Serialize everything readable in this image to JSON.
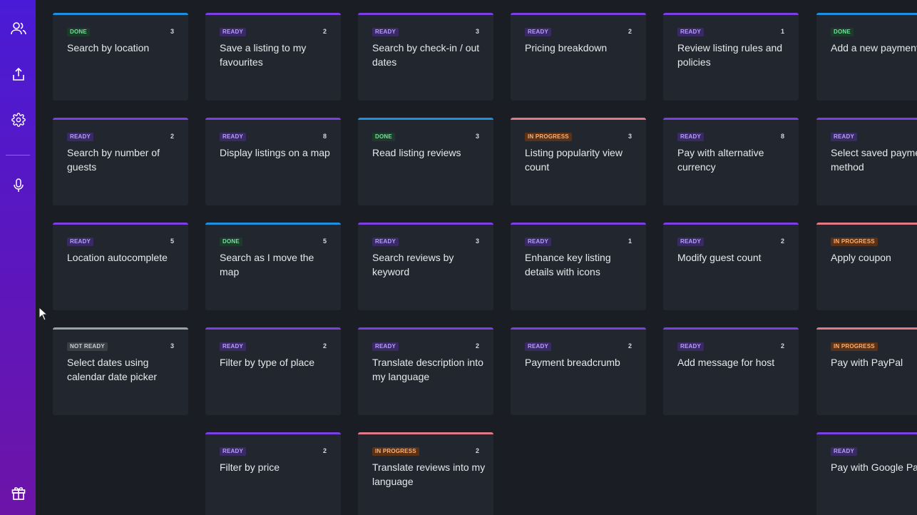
{
  "sidebar": {
    "icons": [
      "users-icon",
      "share-icon",
      "gear-icon",
      "microphone-icon",
      "gift-icon"
    ]
  },
  "columns": [
    {
      "cards": [
        {
          "status": "done",
          "badge": "DONE",
          "count": "3",
          "title": "Search by location"
        },
        {
          "status": "ready",
          "badge": "READY",
          "count": "2",
          "title": "Search by number of guests"
        },
        {
          "status": "ready",
          "badge": "READY",
          "count": "5",
          "title": "Location autocomplete"
        },
        {
          "status": "notready",
          "badge": "NOT READY",
          "count": "3",
          "title": "Select dates using calendar date picker"
        }
      ]
    },
    {
      "cards": [
        {
          "status": "ready",
          "badge": "READY",
          "count": "2",
          "title": "Save a listing to my favourites"
        },
        {
          "status": "ready",
          "badge": "READY",
          "count": "8",
          "title": "Display listings on a map"
        },
        {
          "status": "done",
          "badge": "DONE",
          "count": "5",
          "title": "Search as I move the map"
        },
        {
          "status": "ready",
          "badge": "READY",
          "count": "2",
          "title": "Filter by type of place"
        },
        {
          "status": "ready",
          "badge": "READY",
          "count": "2",
          "title": "Filter by price"
        }
      ]
    },
    {
      "cards": [
        {
          "status": "ready",
          "badge": "READY",
          "count": "3",
          "title": "Search by check-in / out dates"
        },
        {
          "status": "done",
          "badge": "DONE",
          "count": "3",
          "title": "Read listing reviews"
        },
        {
          "status": "ready",
          "badge": "READY",
          "count": "3",
          "title": "Search reviews by keyword"
        },
        {
          "status": "ready",
          "badge": "READY",
          "count": "2",
          "title": "Translate description into my language"
        },
        {
          "status": "inprogress",
          "badge": "IN PROGRESS",
          "count": "2",
          "title": "Translate reviews into my language"
        }
      ]
    },
    {
      "cards": [
        {
          "status": "ready",
          "badge": "READY",
          "count": "2",
          "title": "Pricing breakdown"
        },
        {
          "status": "inprogress",
          "badge": "IN PROGRESS",
          "count": "3",
          "title": "Listing popularity view count"
        },
        {
          "status": "ready",
          "badge": "READY",
          "count": "1",
          "title": "Enhance key listing details with icons"
        },
        {
          "status": "ready",
          "badge": "READY",
          "count": "2",
          "title": "Payment breadcrumb"
        }
      ]
    },
    {
      "cards": [
        {
          "status": "ready",
          "badge": "READY",
          "count": "1",
          "title": "Review listing rules and policies"
        },
        {
          "status": "ready",
          "badge": "READY",
          "count": "8",
          "title": "Pay with alternative currency"
        },
        {
          "status": "ready",
          "badge": "READY",
          "count": "2",
          "title": "Modify guest count"
        },
        {
          "status": "ready",
          "badge": "READY",
          "count": "2",
          "title": "Add message for host"
        }
      ]
    },
    {
      "cards": [
        {
          "status": "done",
          "badge": "DONE",
          "count": "",
          "title": "Add a new payment c"
        },
        {
          "status": "ready",
          "badge": "READY",
          "count": "",
          "title": "Select saved paymer method"
        },
        {
          "status": "inprogress",
          "badge": "IN PROGRESS",
          "count": "",
          "title": "Apply coupon"
        },
        {
          "status": "inprogress",
          "badge": "IN PROGRESS",
          "count": "",
          "title": "Pay with PayPal"
        },
        {
          "status": "ready",
          "badge": "READY",
          "count": "",
          "title": "Pay with Google Pay"
        }
      ]
    }
  ]
}
